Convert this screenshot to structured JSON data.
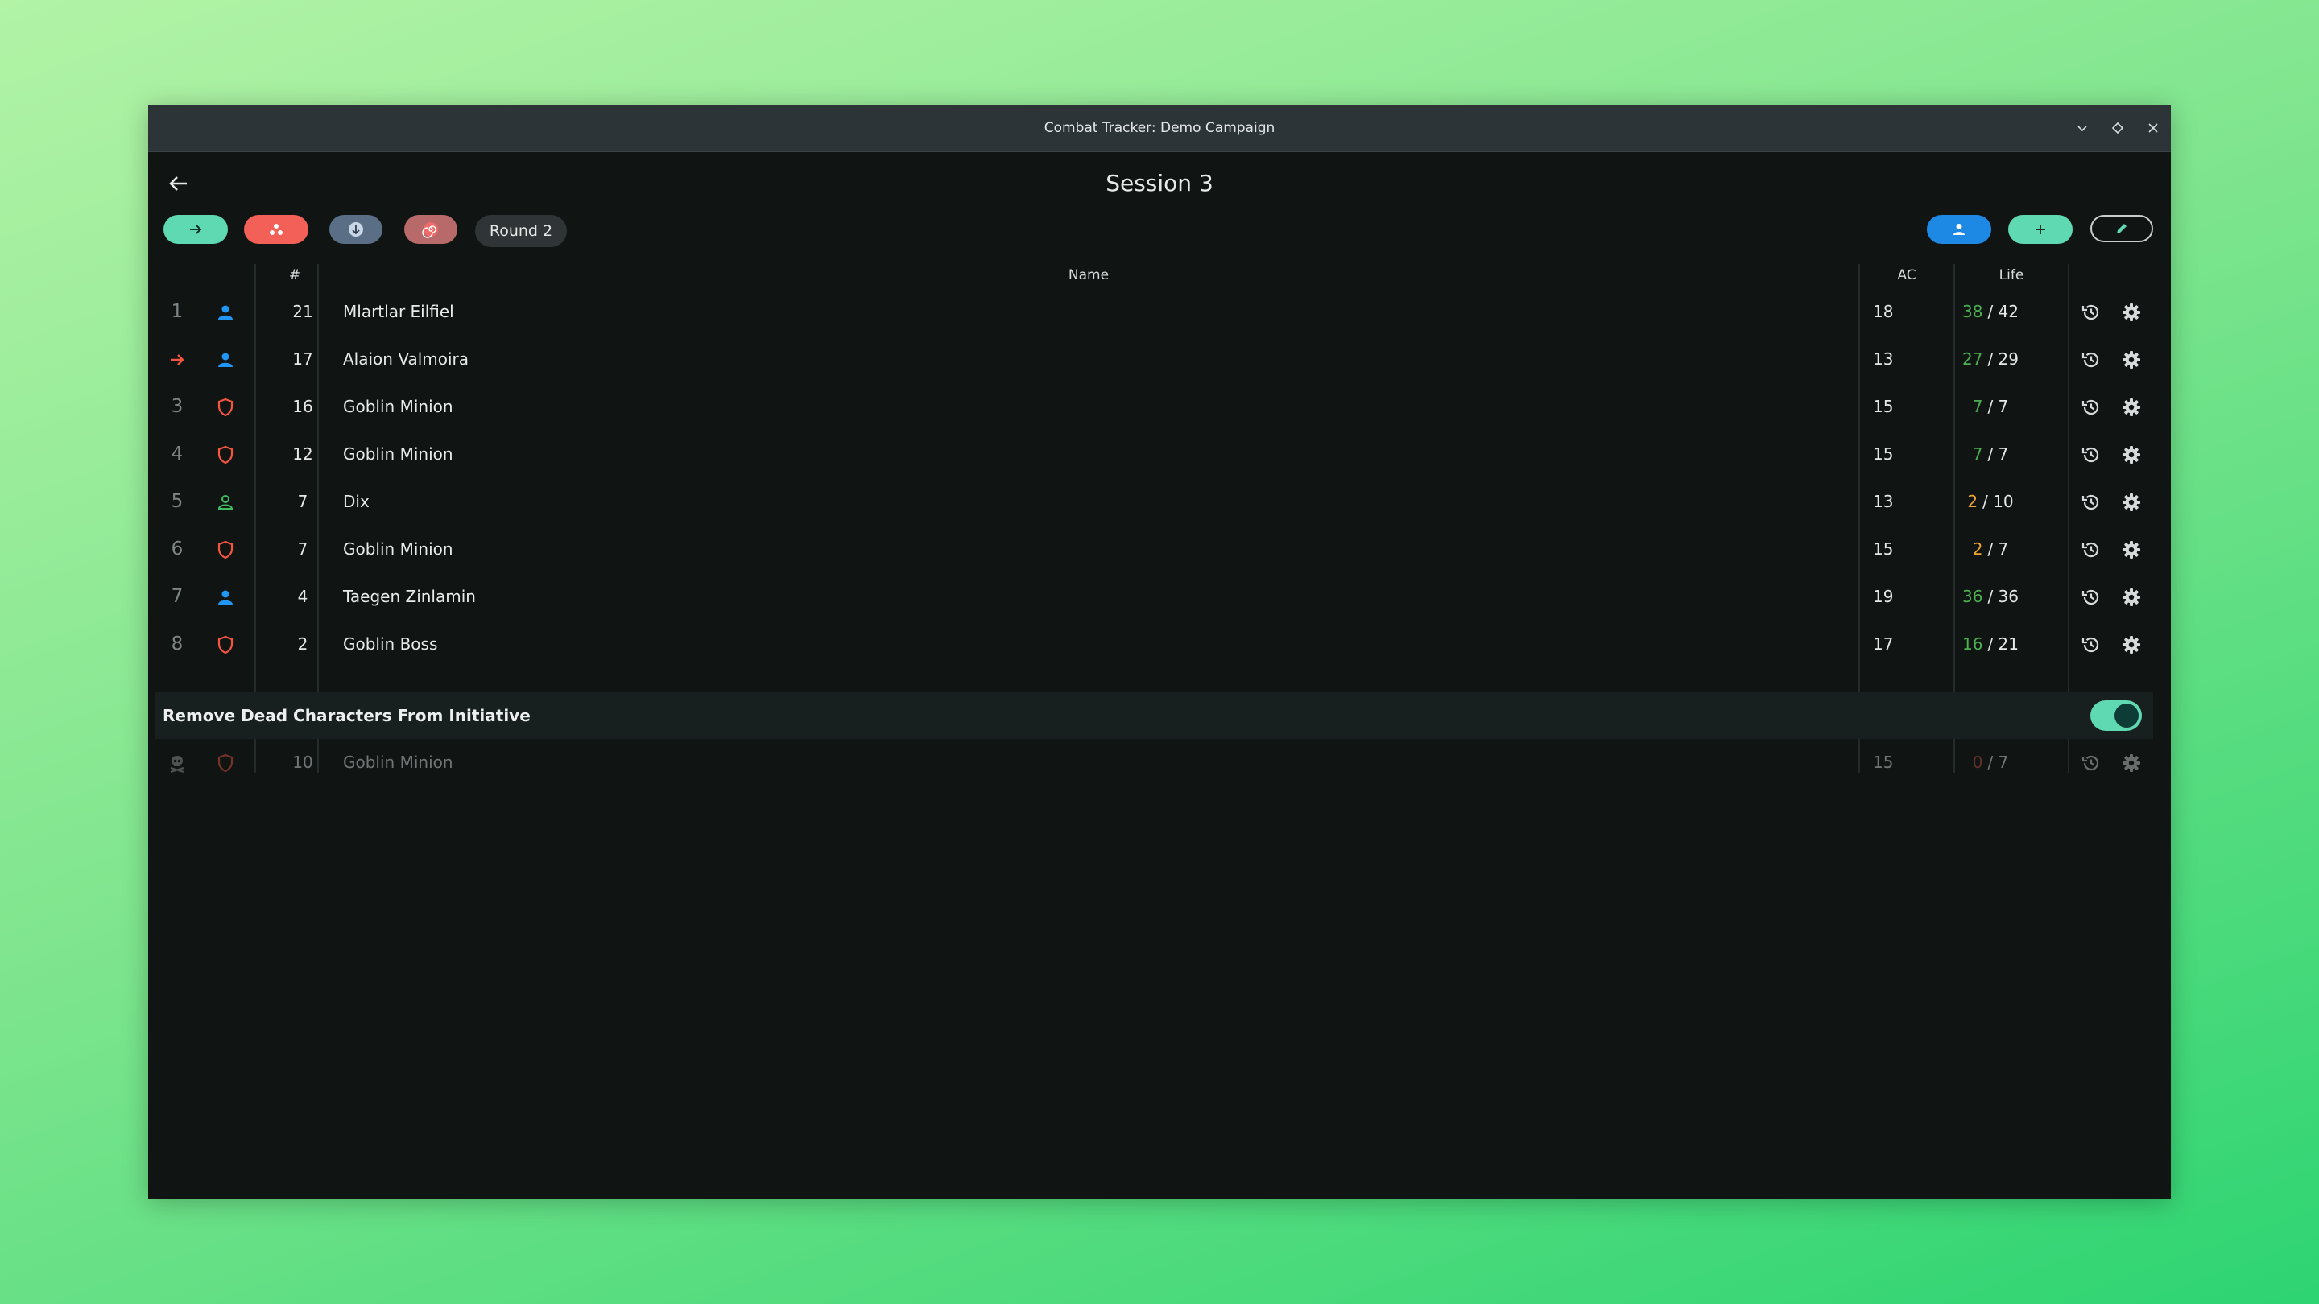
{
  "window": {
    "title": "Combat Tracker: Demo Campaign"
  },
  "header": {
    "session_title": "Session 3"
  },
  "toolbar": {
    "round_label": "Round 2",
    "left_buttons": [
      {
        "icon": "arrow-right-icon",
        "color": "#5fd9b1"
      },
      {
        "icon": "group-icon",
        "color": "#f26058"
      },
      {
        "icon": "sort-down-icon",
        "color": "#5a6e86"
      },
      {
        "icon": "spiral-icon",
        "color": "#b86a6a"
      }
    ],
    "right_buttons": [
      {
        "icon": "person-icon",
        "color": "#1e88e5"
      },
      {
        "icon": "plus-icon",
        "color": "#5fd9b1"
      },
      {
        "icon": "pencil-icon",
        "color": "outline"
      }
    ]
  },
  "table": {
    "headers": {
      "initiative": "#",
      "name": "Name",
      "ac": "AC",
      "life": "Life"
    },
    "rows": [
      {
        "idx": "1",
        "type": "player",
        "initiative": "21",
        "name": "Mlartlar Eilfiel",
        "ac": "18",
        "life_current": "38",
        "life_max": "/ 42",
        "status": "healthy"
      },
      {
        "idx": "",
        "type": "player",
        "initiative": "17",
        "name": "Alaion Valmoira",
        "ac": "13",
        "life_current": "27",
        "life_max": "/ 29",
        "status": "healthy",
        "current_turn": true
      },
      {
        "idx": "3",
        "type": "monster",
        "initiative": "16",
        "name": "Goblin Minion",
        "ac": "15",
        "life_current": "7",
        "life_max": "/ 7",
        "status": "healthy"
      },
      {
        "idx": "4",
        "type": "monster",
        "initiative": "12",
        "name": "Goblin Minion",
        "ac": "15",
        "life_current": "7",
        "life_max": "/ 7",
        "status": "healthy"
      },
      {
        "idx": "5",
        "type": "npc",
        "initiative": "7",
        "name": "Dix",
        "ac": "13",
        "life_current": "2",
        "life_max": "/ 10",
        "status": "wounded"
      },
      {
        "idx": "6",
        "type": "monster",
        "initiative": "7",
        "name": "Goblin Minion",
        "ac": "15",
        "life_current": "2",
        "life_max": "/ 7",
        "status": "wounded"
      },
      {
        "idx": "7",
        "type": "player",
        "initiative": "4",
        "name": "Taegen Zinlamin",
        "ac": "19",
        "life_current": "36",
        "life_max": "/ 36",
        "status": "healthy"
      },
      {
        "idx": "8",
        "type": "monster",
        "initiative": "2",
        "name": "Goblin Boss",
        "ac": "17",
        "life_current": "16",
        "life_max": "/ 21",
        "status": "healthy"
      }
    ]
  },
  "dead_section": {
    "label": "Remove Dead Characters From Initiative",
    "toggle_on": true,
    "rows": [
      {
        "idx": "",
        "type": "monster",
        "initiative": "10",
        "name": "Goblin Minion",
        "ac": "15",
        "life_current": "0",
        "life_max": "/ 7",
        "status": "dead"
      }
    ]
  },
  "colors": {
    "player": "#2196f3",
    "monster": "#f4553f",
    "npc": "#3fbf5f",
    "healthy": "#4caf50",
    "wounded": "#f0a531",
    "dead": "#c0513f",
    "turn_arrow": "#f4553f",
    "accent": "#5fd9b1"
  }
}
